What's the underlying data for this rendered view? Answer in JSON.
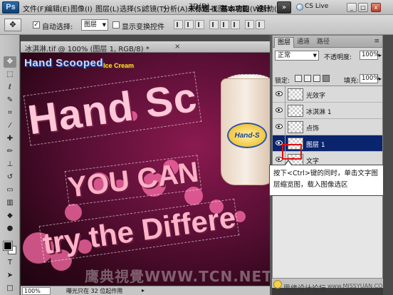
{
  "menubar": {
    "logo": "Ps",
    "items": [
      "文件(F)",
      "编辑(E)",
      "图像(I)",
      "图层(L)",
      "选择(S)",
      "滤镜(T)",
      "分析(A)",
      "3D(D)",
      "视图(V)",
      "窗口(W)",
      "帮助(H)"
    ],
    "doc_title": "未标题-1",
    "workspace": "基本功能",
    "design": "设计",
    "more_btn": "»",
    "cs_live": "CS Live",
    "win_min": "_",
    "win_max": "□",
    "win_close": "x"
  },
  "optbar": {
    "auto_select_label": "自动选择:",
    "auto_select_value": "图层",
    "show_transform_label": "显示变换控件",
    "auto_select_checked": "✓"
  },
  "document": {
    "tab_title": "冰淇淋.tif @ 100% (图层 1, RGB/8) *",
    "tab_close": "×",
    "logo_main": "Hand Scooped",
    "logo_sub": "Ice Cream",
    "headline": "Hand Sc",
    "line2": "YOU CAN",
    "line3": "try the Differe",
    "cup_label": "Hand-S",
    "watermark": "鹰典視覺WWW.TCN.NET"
  },
  "status": {
    "zoom": "100%",
    "info": "曝光只在 32 位起作用",
    "arrow": "▸"
  },
  "layers_panel": {
    "tabs": [
      "图层",
      "通道",
      "路径"
    ],
    "blend_mode": "正常",
    "opacity_label": "不透明度:",
    "opacity_value": "100%",
    "lock_label": "锁定:",
    "fill_label": "填充:",
    "fill_value": "100%",
    "layers": [
      {
        "name": "光效字",
        "selected": false
      },
      {
        "name": "冰淇淋 1",
        "selected": false
      },
      {
        "name": "点饰",
        "selected": false
      },
      {
        "name": "图层 1",
        "selected": true
      },
      {
        "name": "文字",
        "selected": false
      }
    ]
  },
  "callout": {
    "text": "按下<Ctrl>键的同时，单击文字图层缩览图，载入图像选区"
  },
  "footer": {
    "wm_cn": "思缘设计论坛",
    "wm_url": "www.MISSYUAN.COM"
  }
}
